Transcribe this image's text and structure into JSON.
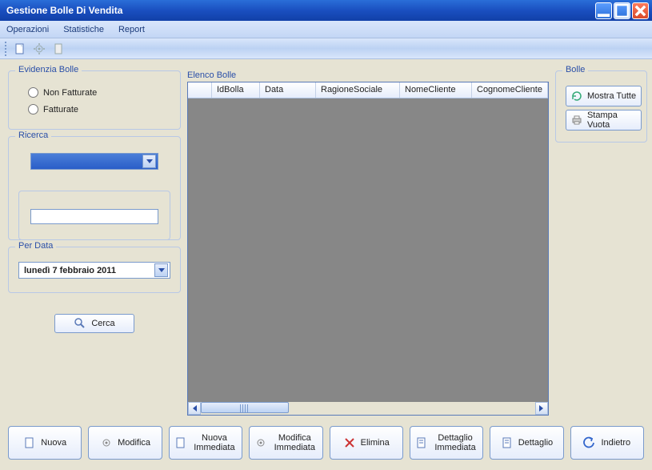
{
  "window": {
    "title": "Gestione Bolle Di Vendita"
  },
  "menu": {
    "operazioni": "Operazioni",
    "statistiche": "Statistiche",
    "report": "Report"
  },
  "left": {
    "evidenzia": {
      "legend": "Evidenzia Bolle",
      "non_fatturate": "Non Fatturate",
      "fatturate": "Fatturate"
    },
    "ricerca": {
      "legend": "Ricerca",
      "combo_value": "",
      "text_value": ""
    },
    "perdata": {
      "legend": "Per Data",
      "value": "lunedì     7  febbraio  2011"
    },
    "cerca": "Cerca"
  },
  "grid": {
    "label": "Elenco Bolle",
    "columns": [
      "IdBolla",
      "Data",
      "RagioneSociale",
      "NomeCliente",
      "CognomeCliente"
    ],
    "rows": []
  },
  "right": {
    "legend": "Bolle",
    "mostra_tutte": "Mostra Tutte",
    "stampa_vuota": "Stampa Vuota"
  },
  "buttons": {
    "nuova": "Nuova",
    "modifica": "Modifica",
    "nuova_immediata": "Nuova Immediata",
    "modifica_immediata": "Modifica Immediata",
    "elimina": "Elimina",
    "dettaglio_immediata": "Dettaglio Immediata",
    "dettaglio": "Dettaglio",
    "indietro": "Indietro"
  }
}
